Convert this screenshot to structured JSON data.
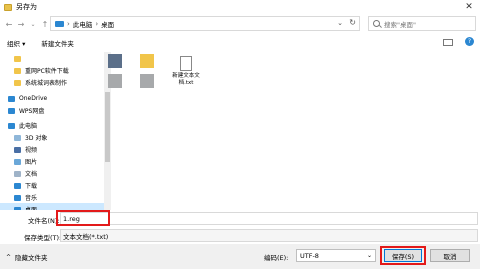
{
  "window": {
    "title": "另存为"
  },
  "nav": {
    "breadcrumb": [
      "此电脑",
      "桌面"
    ],
    "search_placeholder": "搜索\"桌面\""
  },
  "toolbar": {
    "organize_label": "组织 ▾",
    "new_folder_label": "新建文件夹"
  },
  "sidebar": {
    "items": [
      {
        "label": "",
        "icon": "folder-icon",
        "selected": false
      },
      {
        "label": "重网PC软件下载",
        "icon": "folder-icon",
        "selected": false
      },
      {
        "label": "系统城词表制作",
        "icon": "folder-icon",
        "selected": false
      },
      {
        "label": "OneDrive",
        "icon": "cloud-icon",
        "selected": false
      },
      {
        "label": "WPS网盘",
        "icon": "cloud-icon",
        "selected": false
      },
      {
        "label": "此电脑",
        "icon": "computer-icon",
        "selected": false
      },
      {
        "label": "3D 对象",
        "icon": "cube-icon",
        "selected": false
      },
      {
        "label": "视频",
        "icon": "video-icon",
        "selected": false
      },
      {
        "label": "图片",
        "icon": "picture-icon",
        "selected": false
      },
      {
        "label": "文档",
        "icon": "document-icon",
        "selected": false
      },
      {
        "label": "下载",
        "icon": "download-icon",
        "selected": false
      },
      {
        "label": "音乐",
        "icon": "music-icon",
        "selected": false
      },
      {
        "label": "桌面",
        "icon": "desktop-icon",
        "selected": true
      }
    ]
  },
  "files": [
    {
      "name": "",
      "kind": "image"
    },
    {
      "name": "",
      "kind": "folder"
    },
    {
      "name": "新建文本文档.txt",
      "kind": "text-file"
    },
    {
      "name": "",
      "kind": "blurred"
    },
    {
      "name": "",
      "kind": "blurred"
    }
  ],
  "fields": {
    "filename_label": "文件名(N):",
    "filename_value": "1.reg",
    "filetype_label": "保存类型(T):",
    "filetype_value": "文本文档(*.txt)"
  },
  "footer": {
    "hide_folders_label": "隐藏文件夹",
    "encoding_label": "编码(E):",
    "encoding_value": "UTF-8",
    "save_label": "保存(S)",
    "cancel_label": "取消"
  },
  "colors": {
    "accent": "#0078d7",
    "highlight_red": "#e31a1a",
    "selected_bg": "#cce8ff"
  }
}
